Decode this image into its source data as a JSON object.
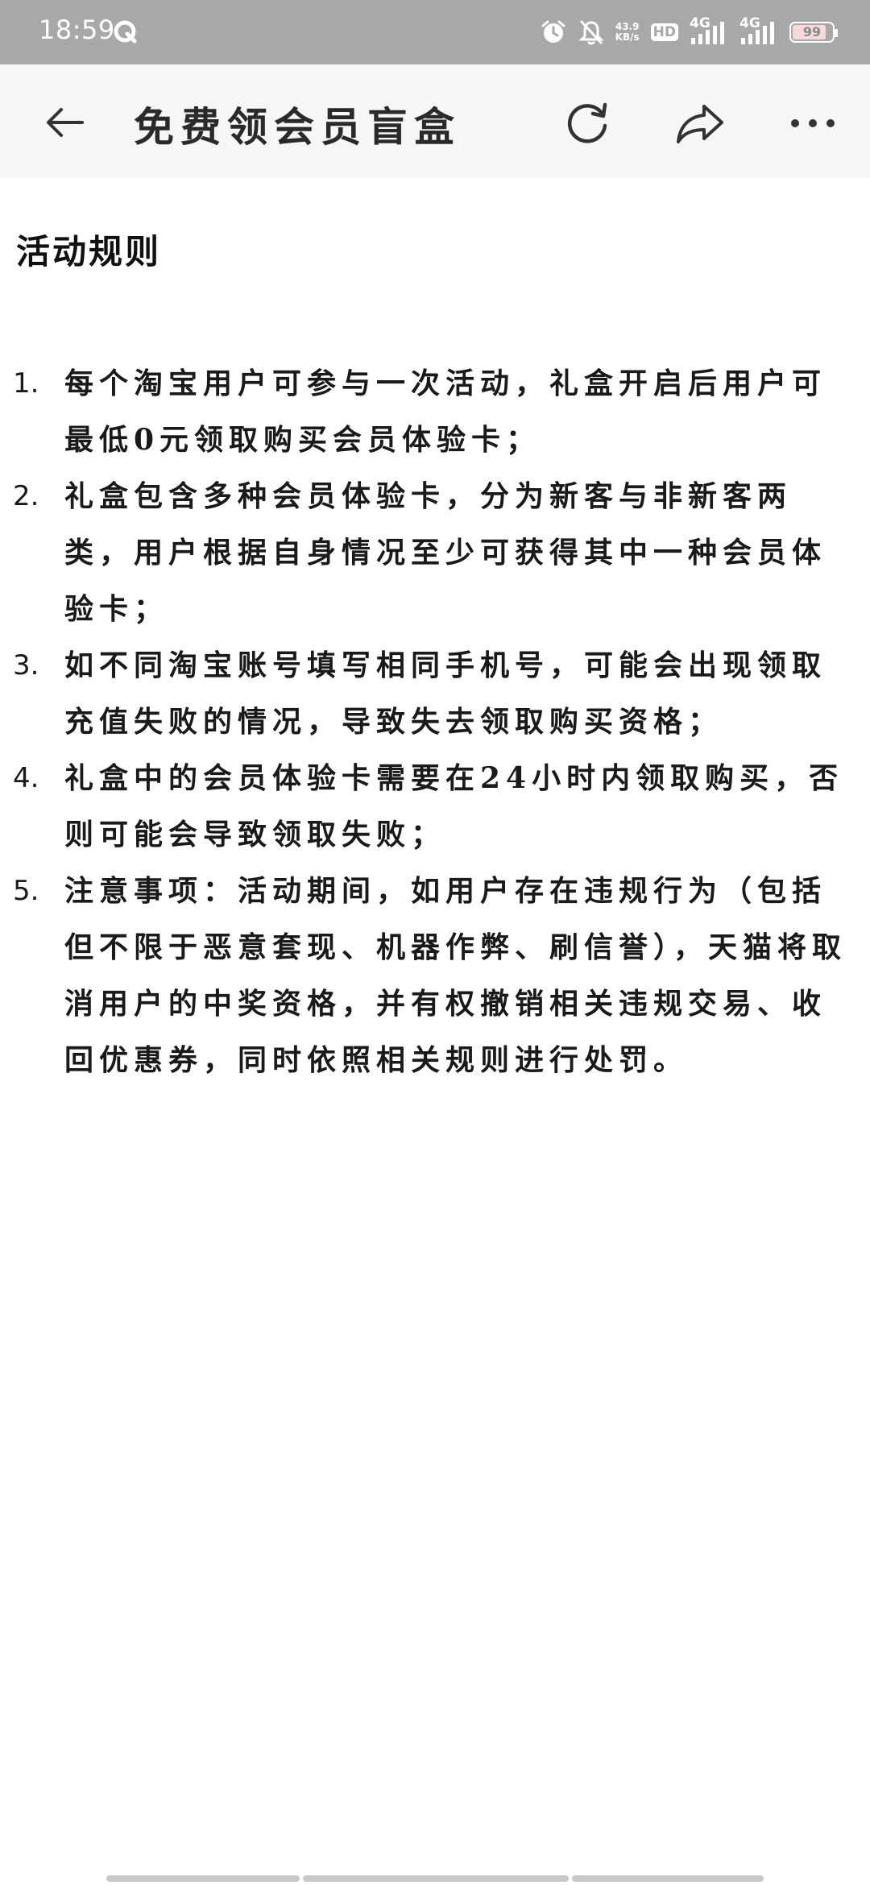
{
  "status_bar": {
    "time": "18:59",
    "net_speed_value": "43.9",
    "net_speed_unit": "KB/s",
    "hd_label": "HD",
    "sim1_label": "4G",
    "sim2_label": "4G",
    "battery_level": "99",
    "icons": [
      "q-app-icon",
      "alarm-icon",
      "mute-bell-icon",
      "hd-voice-icon",
      "signal-4g-icon",
      "signal-4g-icon",
      "battery-icon"
    ]
  },
  "nav": {
    "title": "免费领会员盲盒",
    "back_icon": "back-arrow-icon",
    "refresh_icon": "refresh-icon",
    "share_icon": "share-icon",
    "more_icon": "more-dots-icon"
  },
  "content": {
    "title": "活动规则",
    "rules": [
      {
        "num": "1.",
        "text": "每个淘宝用户可参与一次活动，礼盒开启后用户可最低0元领取购买会员体验卡；"
      },
      {
        "num": "2.",
        "text": "礼盒包含多种会员体验卡，分为新客与非新客两类，用户根据自身情况至少可获得其中一种会员体验卡；"
      },
      {
        "num": "3.",
        "text": "如不同淘宝账号填写相同手机号，可能会出现领取充值失败的情况，导致失去领取购买资格；"
      },
      {
        "num": "4.",
        "text": "礼盒中的会员体验卡需要在24小时内领取购买，否则可能会导致领取失败；"
      },
      {
        "num": "5.",
        "text": "注意事项：活动期间，如用户存在违规行为（包括但不限于恶意套现、机器作弊、刷信誉），天猫将取消用户的中奖资格，并有权撤销相关违规交易、收回优惠券，同时依照相关规则进行处罚。"
      }
    ]
  },
  "colors": {
    "status_bar_bg": "#a8a8a8",
    "nav_bg": "#f6f6f6",
    "text": "#1a1a1a",
    "watermark": "#3b7bd6"
  }
}
